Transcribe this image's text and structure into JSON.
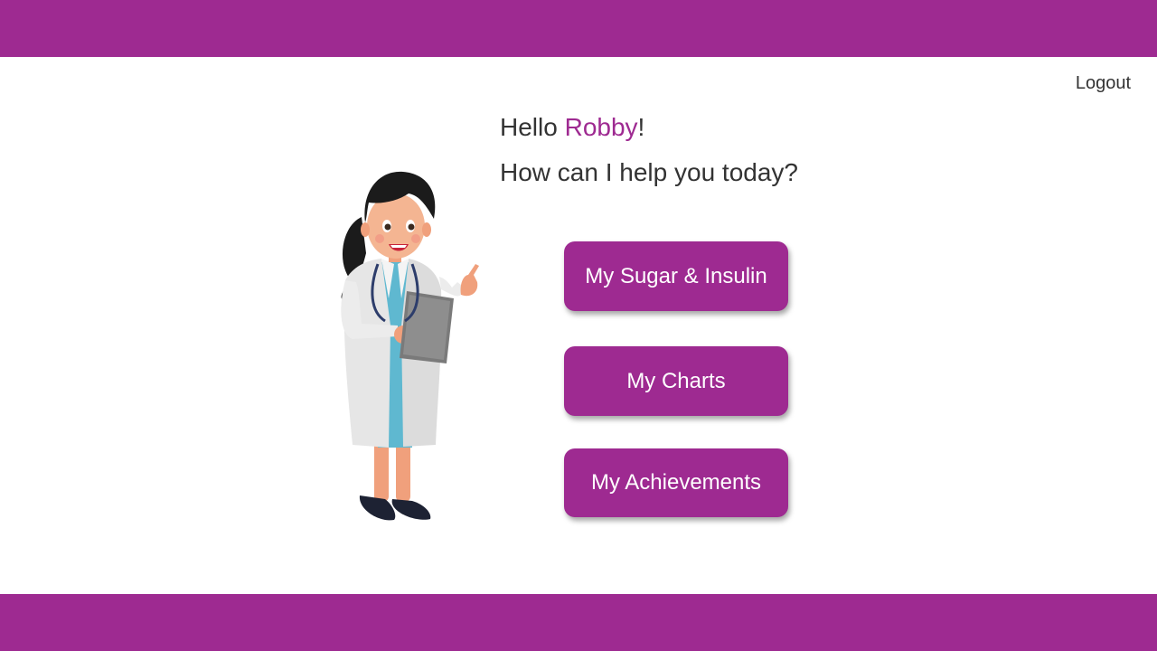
{
  "header": {},
  "nav": {
    "logout_label": "Logout"
  },
  "main": {
    "greeting_prefix": "Hello ",
    "username": "Robby",
    "greeting_suffix": "!",
    "question": "How can I help you today?",
    "buttons": [
      {
        "label": "My Sugar & Insulin"
      },
      {
        "label": "My Charts"
      },
      {
        "label": "My Achievements"
      }
    ]
  },
  "colors": {
    "brand": "#9e2a91",
    "text": "#333333",
    "background": "#ffffff"
  },
  "icons": {
    "illustration": "doctor-illustration"
  }
}
